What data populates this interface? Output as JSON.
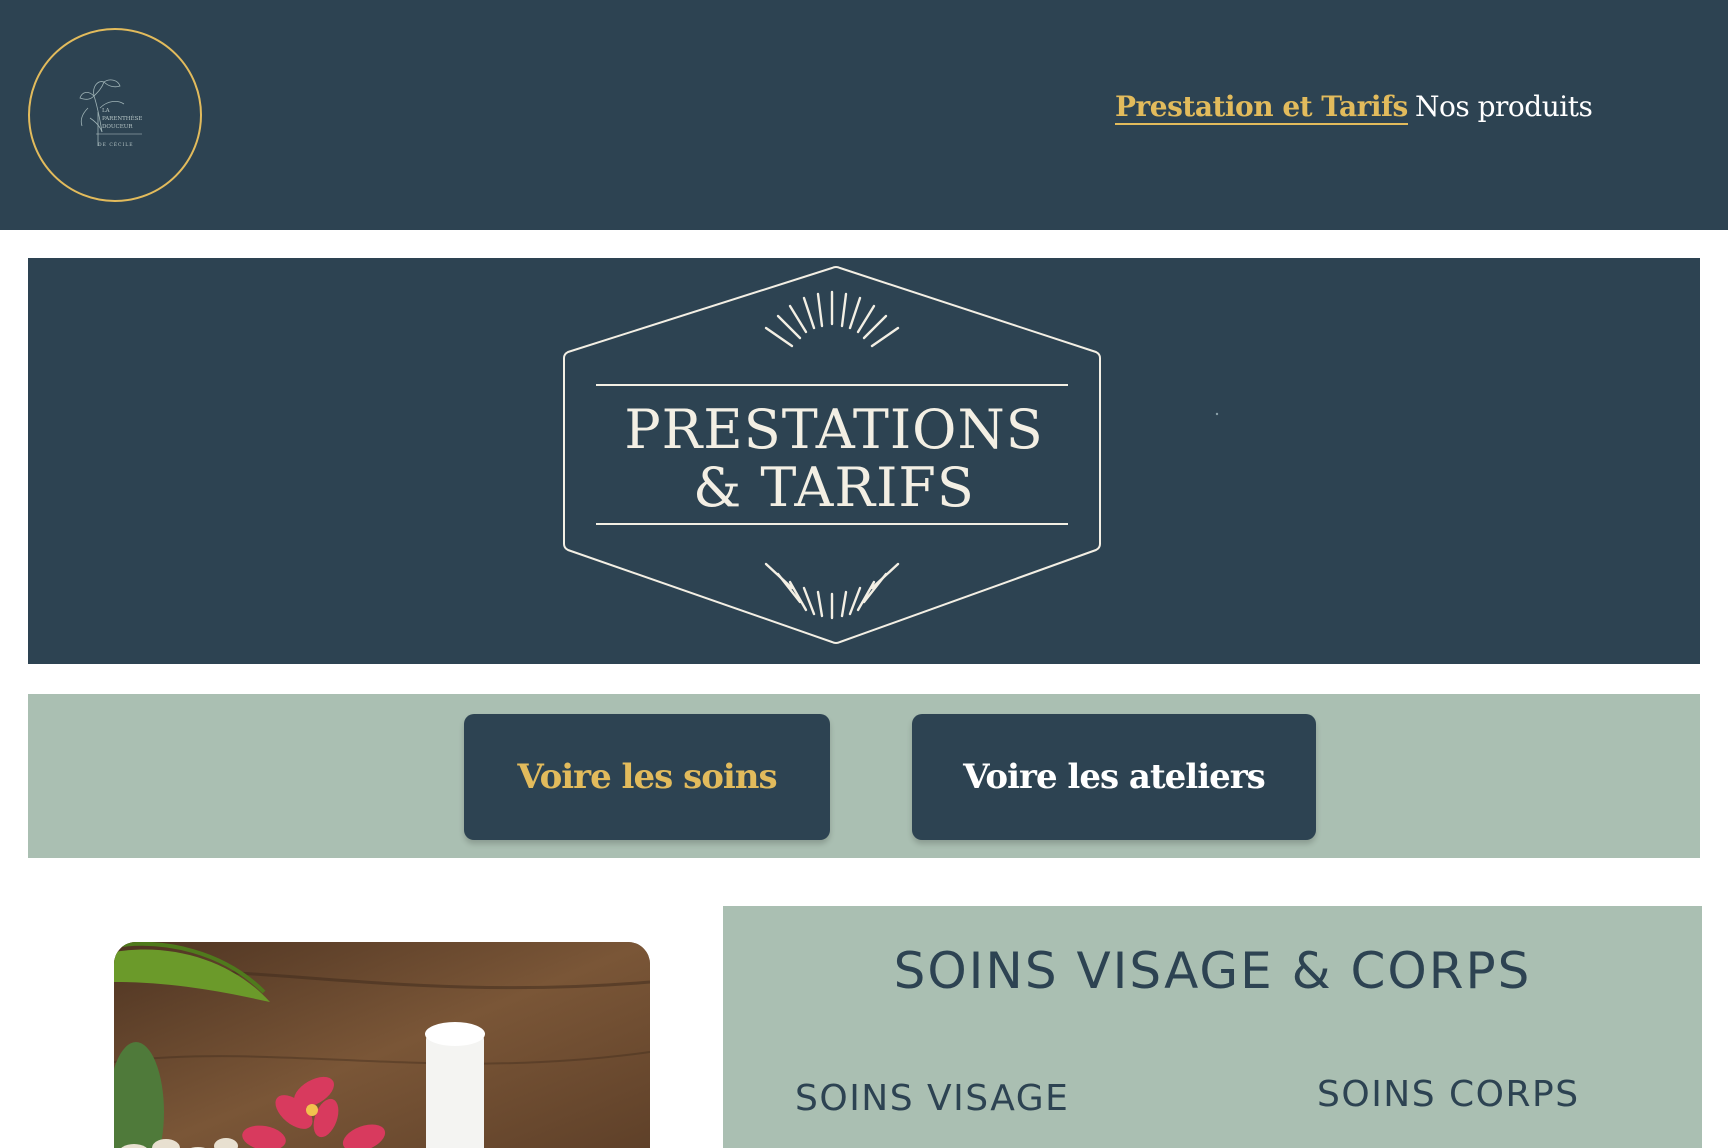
{
  "header": {
    "logo": {
      "icon": "flower-logo",
      "lines": [
        "LA",
        "PARENTHÈSE",
        "DOUCEUR",
        "DE CÉCILE"
      ]
    },
    "nav": [
      {
        "label": "Prestation et Tarifs",
        "active": true
      },
      {
        "label": "Nos produits",
        "active": false
      }
    ]
  },
  "banner": {
    "title_line1": "PRESTATIONS",
    "title_line2": "& TARIFS"
  },
  "buttons": {
    "soins_label": "Voire les soins",
    "ateliers_label": "Voire les ateliers"
  },
  "soins_panel": {
    "title": "SOINS VISAGE & CORPS",
    "visage": "SOINS VISAGE",
    "corps": "SOINS CORPS"
  },
  "colors": {
    "navy": "#2d4352",
    "gold": "#e2bb5c",
    "sage": "#aabfb2",
    "cream": "#f3efe4"
  }
}
